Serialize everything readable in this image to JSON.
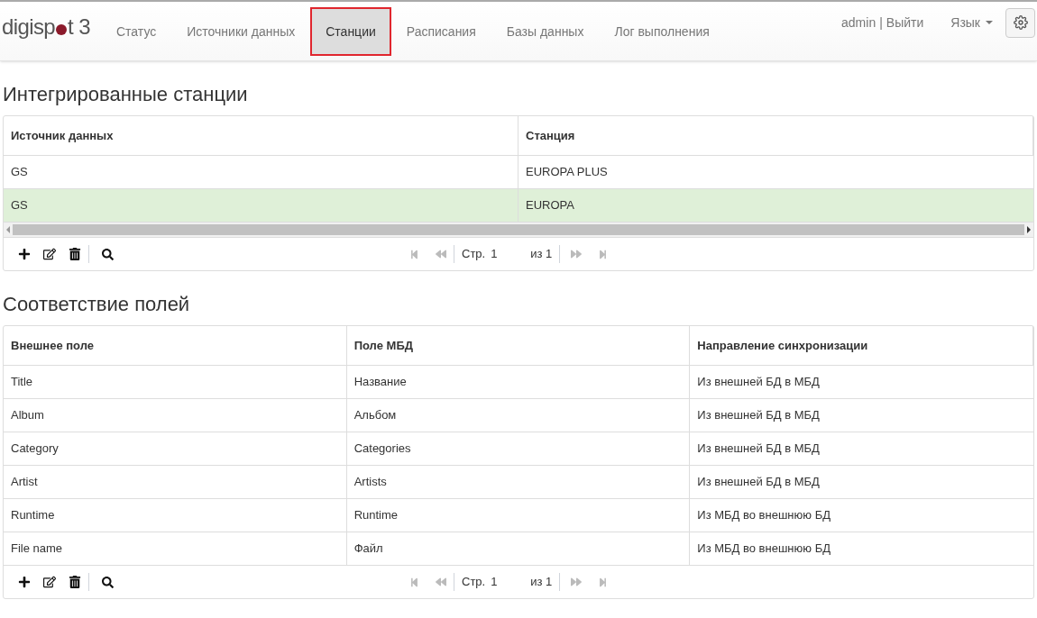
{
  "logo": {
    "left": "digisp",
    "right": "t 3"
  },
  "nav": [
    {
      "label": "Статус",
      "selected": false
    },
    {
      "label": "Источники данных",
      "selected": false
    },
    {
      "label": "Станции",
      "selected": true
    },
    {
      "label": "Расписания",
      "selected": false
    },
    {
      "label": "Базы данных",
      "selected": false
    },
    {
      "label": "Лог выполнения",
      "selected": false
    }
  ],
  "user": {
    "name": "admin",
    "separator": "|",
    "logout": "Выйти"
  },
  "language": "Язык",
  "sections": [
    {
      "title": "Интегрированные станции",
      "scrollbar": true,
      "columns": [
        "Источник данных",
        "Станция"
      ],
      "rows": [
        {
          "cells": [
            "GS",
            "EUROPA PLUS"
          ],
          "selected": false
        },
        {
          "cells": [
            "GS",
            "EUROPA"
          ],
          "selected": true
        }
      ],
      "pager": {
        "page_label": "Стр.",
        "page": "1",
        "of": "из 1"
      }
    },
    {
      "title": "Соответствие полей",
      "scrollbar": false,
      "columns": [
        "Внешнее поле",
        "Поле МБД",
        "Направление синхронизации"
      ],
      "rows": [
        {
          "cells": [
            "Title",
            "Название",
            "Из внешней БД в МБД"
          ],
          "selected": false
        },
        {
          "cells": [
            "Album",
            "Альбом",
            "Из внешней БД в МБД"
          ],
          "selected": false
        },
        {
          "cells": [
            "Category",
            "Categories",
            "Из внешней БД в МБД"
          ],
          "selected": false
        },
        {
          "cells": [
            "Artist",
            "Artists",
            "Из внешней БД в МБД"
          ],
          "selected": false
        },
        {
          "cells": [
            "Runtime",
            "Runtime",
            "Из МБД во внешнюю БД"
          ],
          "selected": false
        },
        {
          "cells": [
            "File name",
            "Файл",
            "Из МБД во внешнюю БД"
          ],
          "selected": false
        }
      ],
      "pager": {
        "page_label": "Стр.",
        "page": "1",
        "of": "из 1"
      }
    }
  ]
}
